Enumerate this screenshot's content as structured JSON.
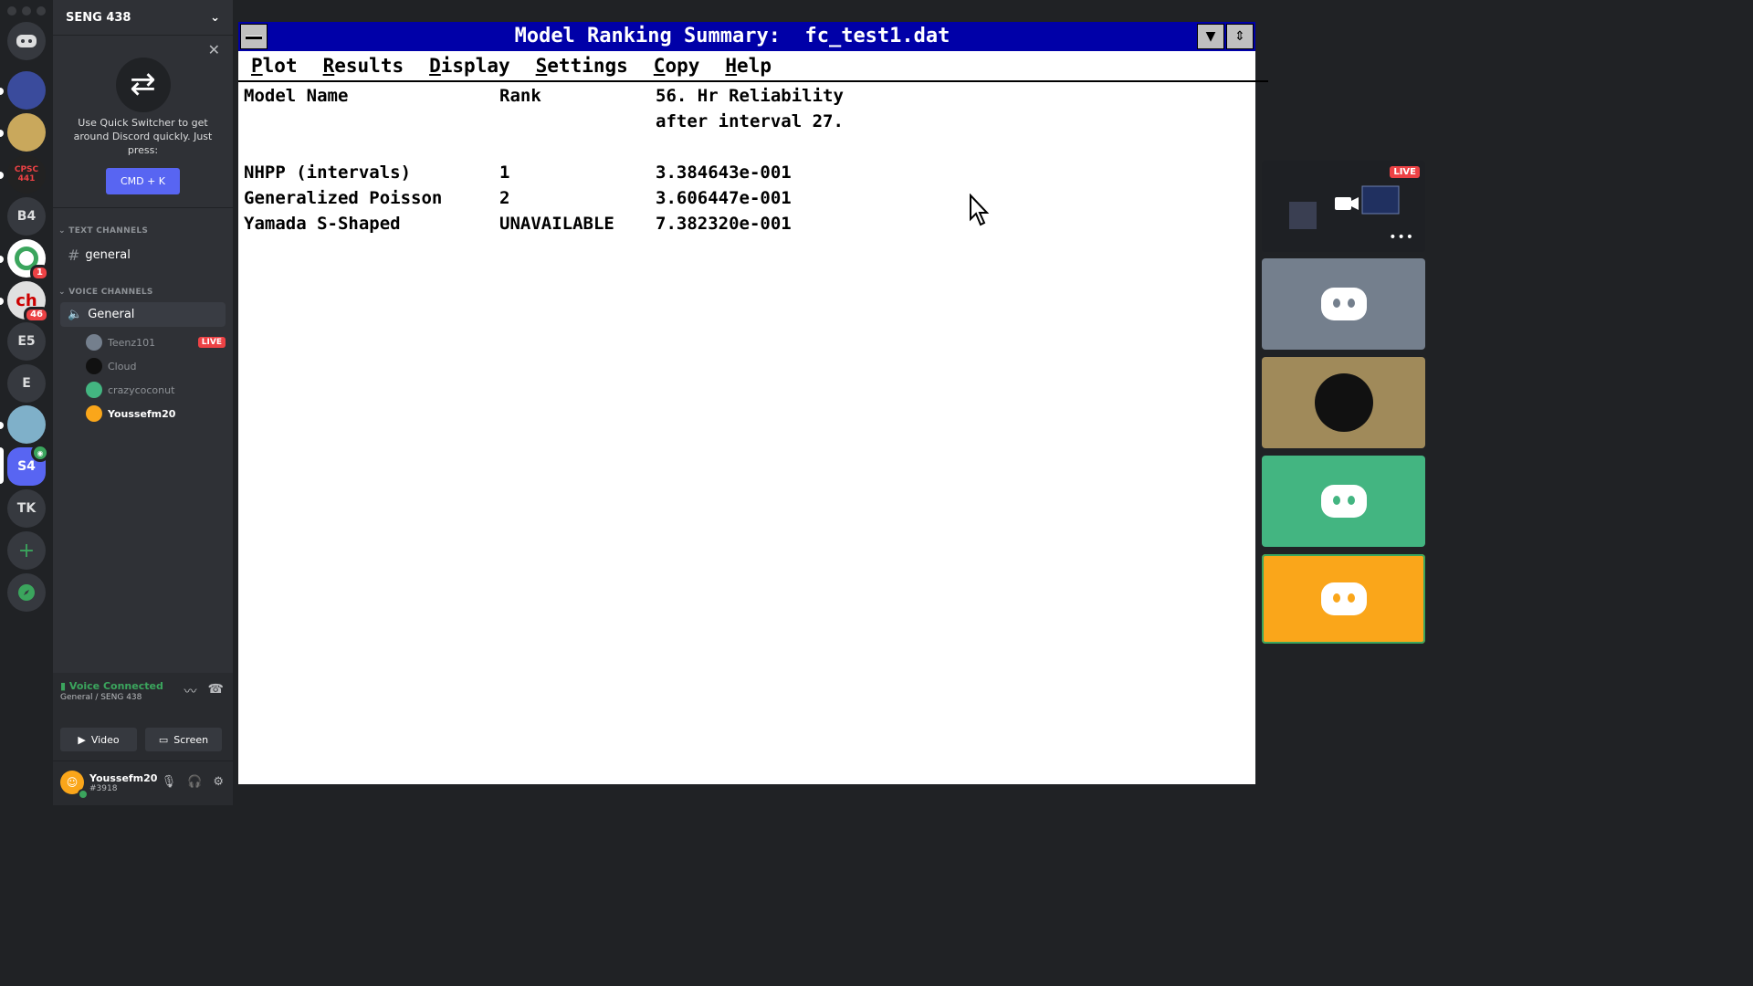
{
  "server_rail": {
    "items": [
      "B4",
      "E5",
      "E",
      "S4",
      "TK"
    ],
    "badges": [
      "1",
      "46"
    ],
    "cpsc_label": "CPSC 441"
  },
  "sidebar": {
    "server_name": "SENG 438",
    "quick_switcher": {
      "text": "Use Quick Switcher to get around Discord quickly. Just press:",
      "shortcut": "CMD + K"
    },
    "text_category": "TEXT CHANNELS",
    "text_channel": "general",
    "voice_category": "VOICE CHANNELS",
    "voice_channel": "General",
    "users": [
      {
        "name": "Teenz101",
        "live": "LIVE"
      },
      {
        "name": "Cloud"
      },
      {
        "name": "crazycoconut"
      },
      {
        "name": "Youssefm20"
      }
    ],
    "voice_status": "Voice Connected",
    "voice_location": "General / SENG 438",
    "video_label": "Video",
    "screen_label": "Screen",
    "user_name": "Youssefm20",
    "user_tag": "#3918"
  },
  "app_window": {
    "title": "Model Ranking Summary:  fc_test1.dat",
    "menu": [
      "Plot",
      "Results",
      "Display",
      "Settings",
      "Copy",
      "Help"
    ],
    "headers": {
      "name": "Model Name",
      "rank": "Rank",
      "reliability_line1": "56. Hr Reliability",
      "reliability_line2": "after interval 27."
    },
    "rows": [
      {
        "name": "NHPP (intervals)",
        "rank": "1",
        "value": "3.384643e-001"
      },
      {
        "name": "Generalized Poisson",
        "rank": "2",
        "value": "3.606447e-001"
      },
      {
        "name": "Yamada S-Shaped",
        "rank": "UNAVAILABLE",
        "value": "7.382320e-001"
      }
    ]
  },
  "tiles": {
    "live_label": "LIVE",
    "colors": [
      "#747f8d",
      "#a08a5a",
      "#43b581",
      "#faa61a"
    ]
  }
}
